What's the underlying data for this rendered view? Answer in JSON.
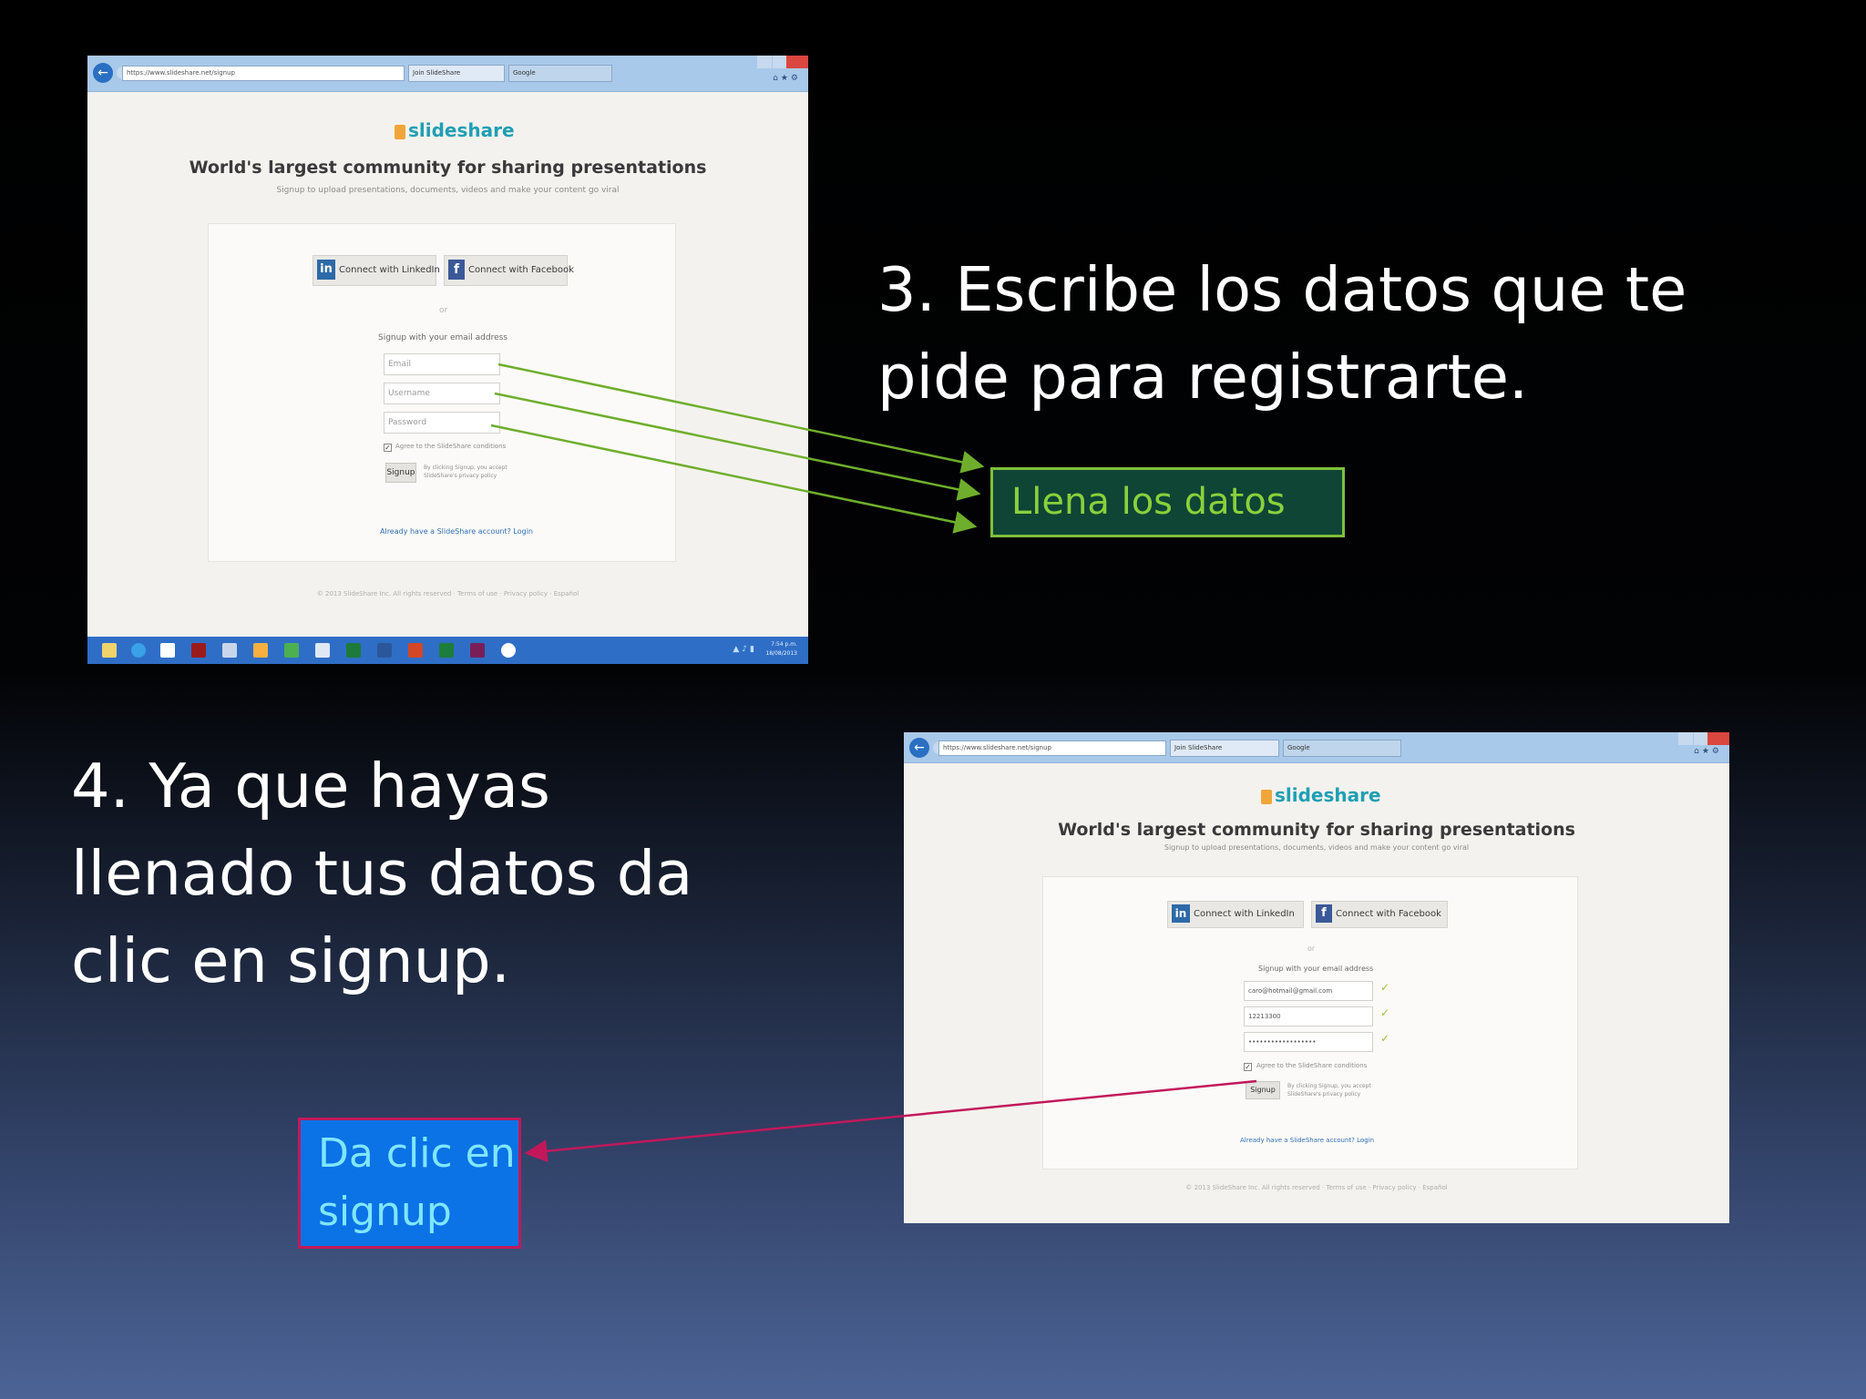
{
  "step3": {
    "line1": "3. Escribe los datos que te",
    "line2": "pide para registrarte."
  },
  "callout_fill": "Llena los datos",
  "step4": {
    "line1": "4. Ya que hayas",
    "line2": "llenado tus datos da",
    "line3": "clic en signup."
  },
  "callout_signup": {
    "line1": "Da clic en",
    "line2": "signup"
  },
  "colors": {
    "arrow_green": "#6fae2c",
    "arrow_magenta": "#c2185b",
    "callout_fill_bg": "#0e4535",
    "callout_signup_bg": "#0b73e5"
  },
  "screenshot_1": {
    "url": "https://www.slideshare.net/signup",
    "tab_active": "Join SlideShare",
    "tab_inactive": "Google",
    "logo": "slideshare",
    "headline": "World's largest community for sharing presentations",
    "subline": "Signup to upload presentations, documents, videos and make your content go viral",
    "linkedin_btn": "Connect with LinkedIn",
    "facebook_btn": "Connect with Facebook",
    "or": "or",
    "signup_label": "Signup with your email address",
    "email_placeholder": "Email",
    "username_placeholder": "Username",
    "password_placeholder": "Password",
    "terms": "Agree to the SlideShare conditions",
    "signup_button": "Signup",
    "signup_note": "By clicking Signup, you accept",
    "signup_note2": "SlideShare's privacy policy",
    "login_link": "Already have a SlideShare account? Login",
    "footer": "© 2013 SlideShare Inc. All rights reserved · Terms of use · Privacy policy · Español",
    "clock_time": "7:54 p.m.",
    "clock_date": "18/08/2013"
  },
  "screenshot_2": {
    "url": "https://www.slideshare.net/signup",
    "tab_active": "Join SlideShare",
    "tab_inactive": "Google",
    "logo": "slideshare",
    "headline": "World's largest community for sharing presentations",
    "subline": "Signup to upload presentations, documents, videos and make your content go viral",
    "linkedin_btn": "Connect with LinkedIn",
    "facebook_btn": "Connect with Facebook",
    "or": "or",
    "signup_label": "Signup with your email address",
    "email_value": "caro@hotmail@gmail.com",
    "username_value": "12213300",
    "password_value": "••••••••••••••••••",
    "terms": "Agree to the SlideShare conditions",
    "signup_button": "Signup",
    "signup_note": "By clicking Signup, you accept",
    "signup_note2": "SlideShare's privacy policy",
    "login_link": "Already have a SlideShare account? Login",
    "footer": "© 2013 SlideShare Inc. All rights reserved · Terms of use · Privacy policy · Español"
  }
}
